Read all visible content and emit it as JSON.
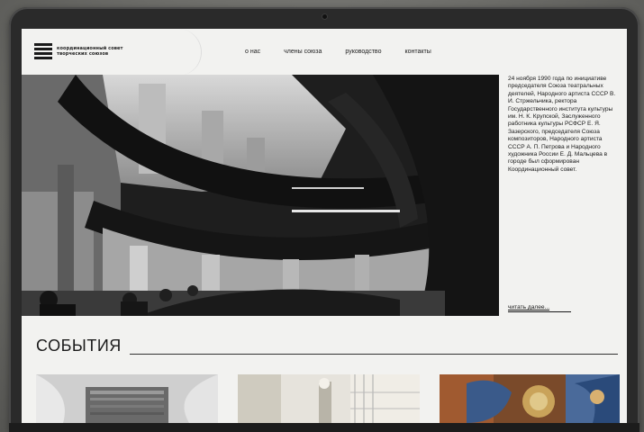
{
  "logo": {
    "line1": "координационный совет",
    "line2": "творческих союзов"
  },
  "nav": {
    "items": [
      {
        "label": "о нас"
      },
      {
        "label": "члены союза"
      },
      {
        "label": "руководство"
      },
      {
        "label": "контакты"
      }
    ]
  },
  "intro": {
    "text": "24 ноября 1990 года по инициативе председателя Союза театральных деятелей, Народного артиста СССР В. И. Стржельчика, ректора Государственного института культуры им. Н. К. Крупской, Заслуженного работника культуры РСФСР Е. Я. Зазерского, председателя Союза композиторов, Народного артиста СССР А. П. Петрова и Народного художника России Е. Д. Мальцева в городе был сформирован Координационный совет.",
    "read_more": "читать далее..."
  },
  "events": {
    "heading": "СОБЫТИЯ"
  },
  "colors": {
    "page_bg": "#f2f2f0",
    "text": "#1a1a1a",
    "frame": "#2a2a2a"
  }
}
